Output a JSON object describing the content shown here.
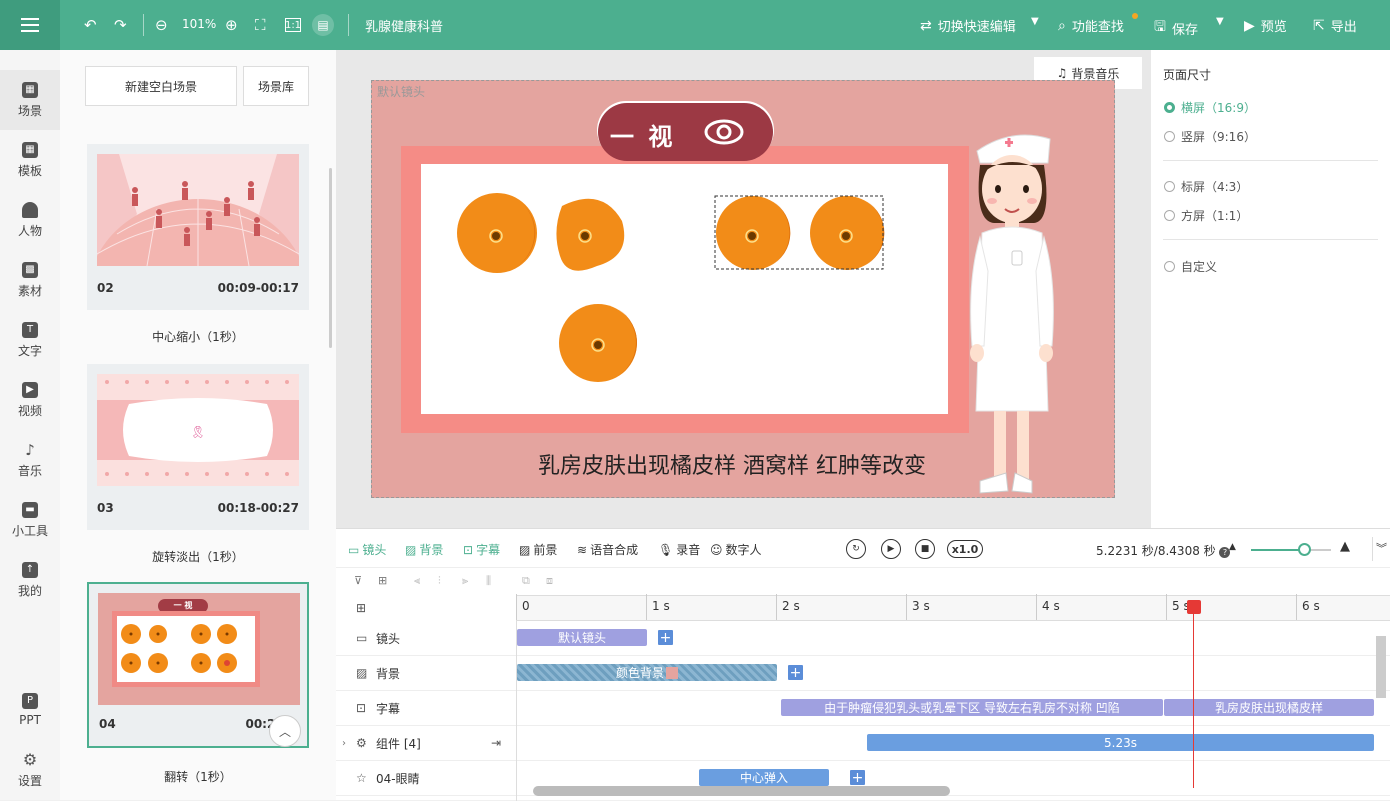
{
  "topbar": {
    "zoom": "101%",
    "doc_title": "乳腺健康科普",
    "switch_edit": "切换快速编辑",
    "func_search": "功能查找",
    "save": "保存",
    "preview": "预览",
    "export": "导出"
  },
  "nav": {
    "scene": "场景",
    "template": "模板",
    "character": "人物",
    "material": "素材",
    "text": "文字",
    "video": "视频",
    "music": "音乐",
    "tools": "小工具",
    "mine": "我的",
    "ppt": "PPT",
    "settings": "设置"
  },
  "scenes": {
    "new_blank": "新建空白场景",
    "library": "场景库",
    "items": [
      {
        "num": "02",
        "time": "00:09-00:17",
        "transition": "中心缩小（1秒）"
      },
      {
        "num": "03",
        "time": "00:18-00:27",
        "transition": "旋转淡出（1秒）"
      },
      {
        "num": "04",
        "time": "00:28-0",
        "transition": "翻转（1秒）",
        "thumb_title": "一 视"
      }
    ]
  },
  "canvas": {
    "bg_music": "背景音乐",
    "default_shot": "默认镜头",
    "banner": "一 视",
    "caption": "乳房皮肤出现橘皮样 酒窝样 红肿等改变"
  },
  "page_size": {
    "title": "页面尺寸",
    "options": [
      {
        "label": "横屏（16:9）",
        "selected": true
      },
      {
        "label": "竖屏（9:16）",
        "selected": false
      },
      {
        "label": "标屏（4:3）",
        "selected": false
      },
      {
        "label": "方屏（1:1）",
        "selected": false
      },
      {
        "label": "自定义",
        "selected": false
      }
    ]
  },
  "timeline": {
    "tabs": [
      "镜头",
      "背景",
      "字幕",
      "前景",
      "语音合成",
      "录音",
      "数字人"
    ],
    "speed": "x1.0",
    "time_info": "5.2231 秒/8.4308 秒",
    "ruler": [
      "0",
      "1 s",
      "2 s",
      "3 s",
      "4 s",
      "5 s",
      "6 s"
    ],
    "tracks": [
      {
        "label": "镜头",
        "icon": "camera-icon"
      },
      {
        "label": "背景",
        "icon": "background-icon"
      },
      {
        "label": "字幕",
        "icon": "subtitle-icon"
      },
      {
        "label": "组件 [4]",
        "icon": "component-icon"
      },
      {
        "label": "04-眼睛",
        "icon": "star-icon"
      }
    ],
    "clips": {
      "shot": "默认镜头",
      "bg": "颜色背景",
      "sub1": "由于肿瘤侵犯乳头或乳晕下区 导致左右乳房不对称 凹陷",
      "sub2": "乳房皮肤出现橘皮样",
      "comp": "5.23s",
      "eye": "中心弹入"
    }
  },
  "colors": {
    "accent": "#4caf8f",
    "clip_purple": "#9fa0e0",
    "clip_blue": "#6a9ee0",
    "playhead": "#e53935"
  }
}
